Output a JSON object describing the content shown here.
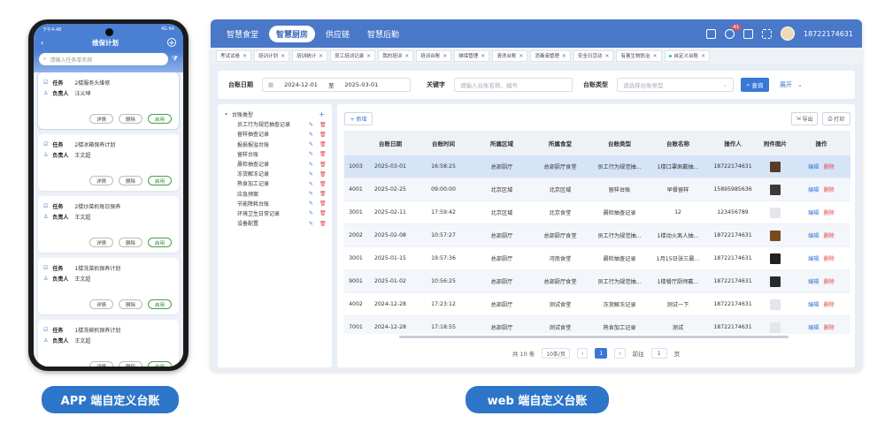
{
  "app": {
    "status_time": "下午4:48",
    "status_right": "4G 64",
    "title": "维保计划",
    "search_placeholder": "请输入任务单名称",
    "task_label": "任务",
    "owner_label": "负责人",
    "cards": [
      {
        "task": "2楼服务头维修",
        "owner": "汪义坤"
      },
      {
        "task": "2楼冰箱保养计划",
        "owner": "王文超"
      },
      {
        "task": "2楼炒菜机每日保养",
        "owner": "王文超"
      },
      {
        "task": "1楼洗菜机保养计划",
        "owner": "王文超"
      },
      {
        "task": "1楼洗碗机保养计划",
        "owner": "王文超"
      }
    ],
    "btn_detail": "详情",
    "btn_delete": "删除",
    "btn_enable": "启用"
  },
  "captions": {
    "app": "APP 端自定义台账",
    "web": "web 端自定义台账"
  },
  "web": {
    "nav": [
      "智慧食堂",
      "智慧厨房",
      "供应链",
      "智慧后勤"
    ],
    "nav_active": 1,
    "badge": "41",
    "phone": "18722174631",
    "tabs": [
      "考试试卷",
      "培训计划",
      "培训统计",
      "员工培训记录",
      "我的培训",
      "培训台账",
      "维保管理",
      "清洗台账",
      "消毒液管理",
      "安全日活动",
      "有害生物防治",
      "自定义台账"
    ],
    "filter": {
      "date_label": "台账日期",
      "date_from": "2024-12-01",
      "date_sep": "至",
      "date_to": "2025-03-01",
      "kw_label": "关键字",
      "kw_placeholder": "请输入台账名称、编号",
      "type_label": "台账类型",
      "type_placeholder": "请选择台账类型",
      "query": "查询",
      "expand": "展开"
    },
    "tree": {
      "root": "台账类型",
      "items": [
        "员工行为规范抽查记录",
        "留样抽查记录",
        "报损报溢台账",
        "留样台账",
        "晨检抽查记录",
        "冻货解冻记录",
        "熟食加工记录",
        "应急预案",
        "节能降耗台账",
        "环境卫生日常记录",
        "设备配置"
      ]
    },
    "toolbar": {
      "add": "+ 新增",
      "export": "导出",
      "print": "打印"
    },
    "columns": [
      "台账日期",
      "台账时间",
      "所属区域",
      "所属食堂",
      "台账类型",
      "台账名称",
      "操作人",
      "附件图片",
      "操作"
    ],
    "rows": [
      {
        "id": "1003",
        "date": "2025-03-01",
        "time": "16:58:25",
        "area": "总部厨厅",
        "canteen": "总部厨厅食堂",
        "type": "员工行为规范抽...",
        "name": "1楼口罩佩戴抽...",
        "user": "18722174631",
        "img": "#5a3b2a"
      },
      {
        "id": "4001",
        "date": "2025-02-25",
        "time": "09:00:00",
        "area": "北京区域",
        "canteen": "北京区域",
        "type": "留样台账",
        "name": "早餐留样",
        "user": "15895985636",
        "img": "#3a3a3a"
      },
      {
        "id": "3001",
        "date": "2025-02-11",
        "time": "17:59:42",
        "area": "北京区域",
        "canteen": "北京食堂",
        "type": "晨检抽查记录",
        "name": "12",
        "user": "123456789",
        "img": "#e4e6ea"
      },
      {
        "id": "2002",
        "date": "2025-02-08",
        "time": "10:57:27",
        "area": "总部厨厅",
        "canteen": "总部厨厅食堂",
        "type": "员工行为规范抽...",
        "name": "1楼动火离人抽...",
        "user": "18722174631",
        "img": "#7a4a20"
      },
      {
        "id": "3001",
        "date": "2025-01-15",
        "time": "19:57:36",
        "area": "总部厨厅",
        "canteen": "河南食堂",
        "type": "晨检抽查记录",
        "name": "1月15日张三晨...",
        "user": "18722174631",
        "img": "#222222"
      },
      {
        "id": "9001",
        "date": "2025-01-02",
        "time": "10:56:25",
        "area": "总部厨厅",
        "canteen": "总部厨厅食堂",
        "type": "员工行为规范抽...",
        "name": "1楼餐厅厨师戴...",
        "user": "18722174631",
        "img": "#2a2a2a"
      },
      {
        "id": "4002",
        "date": "2024-12-28",
        "time": "17:23:12",
        "area": "总部厨厅",
        "canteen": "测试食堂",
        "type": "冻货解冻记录",
        "name": "测试一下",
        "user": "18722174631",
        "img": "#e4e6ea"
      },
      {
        "id": "7001",
        "date": "2024-12-28",
        "time": "17:18:55",
        "area": "总部厨厅",
        "canteen": "测试食堂",
        "type": "熟食加工记录",
        "name": "测试",
        "user": "18722174631",
        "img": "#e4e6ea"
      }
    ],
    "op_edit": "编辑",
    "op_delete": "删除",
    "pager": {
      "total": "共 10 条",
      "size": "10条/页",
      "page": "1",
      "goto": "前往",
      "goto_val": "1",
      "unit": "页"
    }
  }
}
